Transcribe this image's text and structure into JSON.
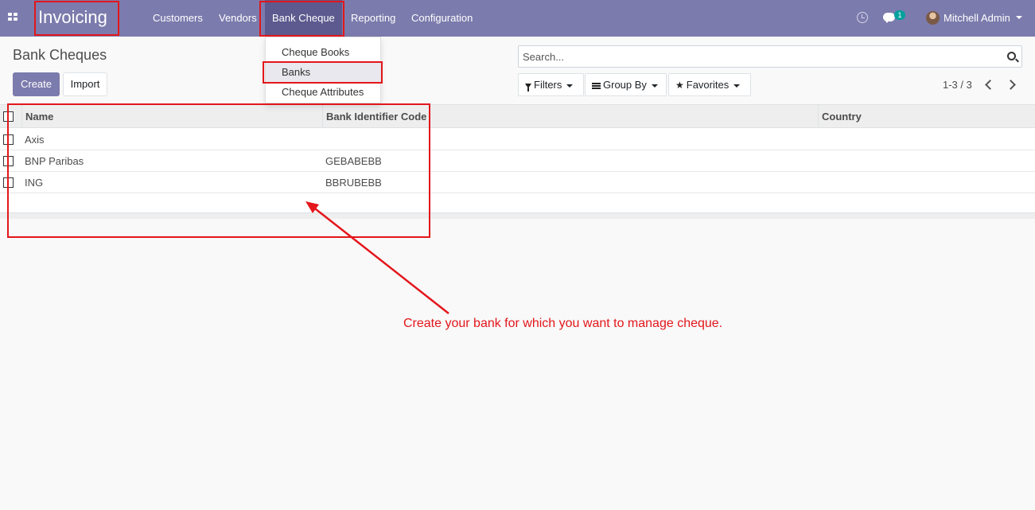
{
  "navbar": {
    "brand": "Invoicing",
    "menu": [
      {
        "label": "Customers"
      },
      {
        "label": "Vendors"
      },
      {
        "label": "Bank Cheque"
      },
      {
        "label": "Reporting"
      },
      {
        "label": "Configuration"
      }
    ],
    "chat_badge": "1",
    "user": "Mitchell Admin",
    "accent_color": "#7c7bad"
  },
  "dropdown": {
    "items": [
      {
        "label": "Cheque Books"
      },
      {
        "label": "Banks"
      },
      {
        "label": "Cheque Attributes"
      }
    ],
    "active_item": "Banks"
  },
  "control_panel": {
    "title": "Bank Cheques",
    "create_label": "Create",
    "import_label": "Import",
    "search_placeholder": "Search...",
    "filters_label": "Filters",
    "groupby_label": "Group By",
    "favorites_label": "Favorites",
    "pager": "1-3 / 3"
  },
  "list": {
    "columns": [
      "Name",
      "Bank Identifier Code",
      "Country"
    ],
    "rows": [
      {
        "name": "Axis",
        "bic": "",
        "country": ""
      },
      {
        "name": "BNP Paribas",
        "bic": "GEBABEBB",
        "country": ""
      },
      {
        "name": "ING",
        "bic": "BBRUBEBB",
        "country": ""
      }
    ]
  },
  "annotation": {
    "text": "Create your bank for which you want to manage cheque.",
    "color": "#e3161b"
  }
}
